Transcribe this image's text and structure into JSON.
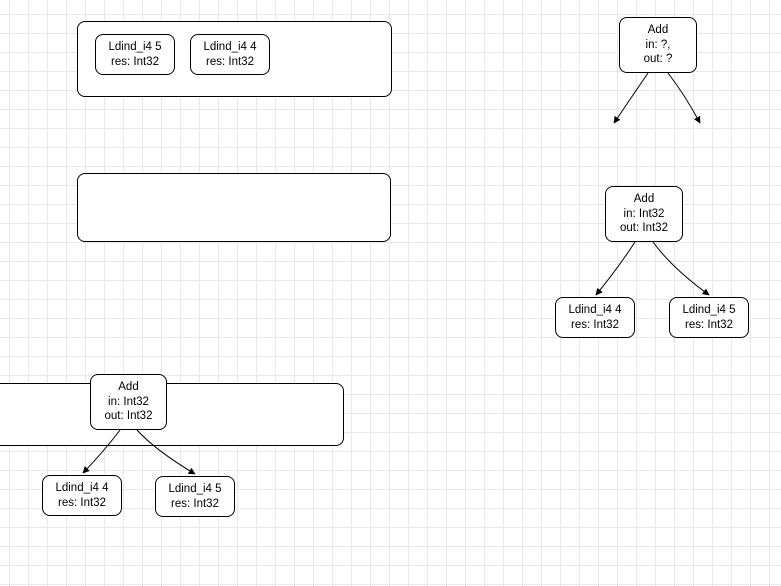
{
  "stacks": {
    "top": {
      "item1": {
        "op": "Ldind_i4 5",
        "res": "res: Int32"
      },
      "item2": {
        "op": "Ldind_i4 4",
        "res": "res: Int32"
      }
    },
    "bottom": {
      "add": {
        "title": "Add",
        "in": "in: Int32",
        "out": "out: Int32"
      },
      "child_left": {
        "op": "Ldind_i4 4",
        "res": "res: Int32"
      },
      "child_right": {
        "op": "Ldind_i4 5",
        "res": "res: Int32"
      }
    }
  },
  "trees": {
    "top": {
      "add": {
        "title": "Add",
        "in": "in: ?,",
        "out": "out: ?"
      }
    },
    "mid": {
      "add": {
        "title": "Add",
        "in": "in: Int32",
        "out": "out: Int32"
      },
      "child_left": {
        "op": "Ldind_i4 4",
        "res": "res: Int32"
      },
      "child_right": {
        "op": "Ldind_i4 5",
        "res": "res: Int32"
      }
    }
  }
}
